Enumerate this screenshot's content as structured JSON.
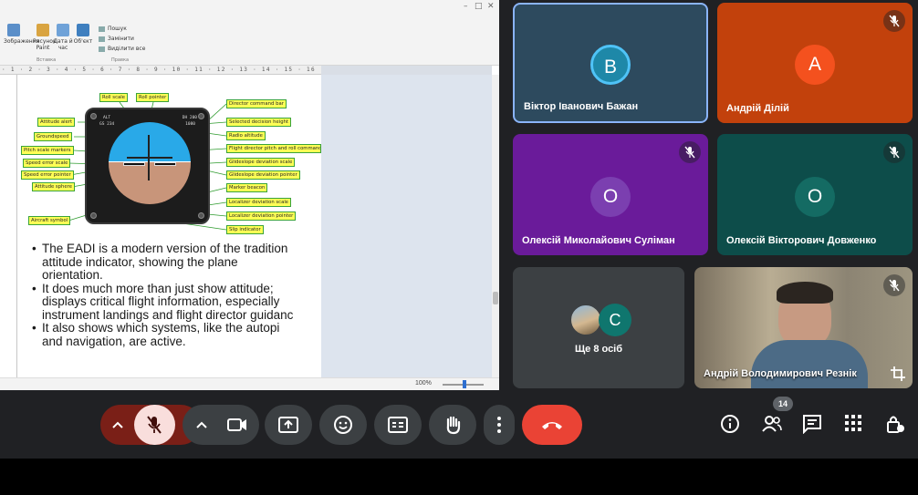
{
  "presentation": {
    "ribbon": {
      "buttons": [
        "Зображення",
        "Рисунок Paint",
        "Дата й час",
        "Об'єкт"
      ],
      "right_items": [
        "Пошук",
        "Замінити",
        "Виділити все"
      ],
      "groups": [
        "Вставка",
        "Правка"
      ]
    },
    "ruler_text": "· 1 · 2 · 3 · 4 · 5 · 6 · 7 · 8 · 9 · 10 · 11 · 12 · 13 · 14 · 15 · 16 · 17 ·",
    "zoom_label": "100%",
    "eadi_callouts": [
      "Roll scale",
      "Roll pointer",
      "Attitude alert",
      "Groundspeed",
      "Pitch scale markers",
      "Speed error scale",
      "Speed error pointer",
      "Attitude sphere",
      "Aircraft symbol",
      "Director command bar",
      "Selected decision height",
      "Radio altitude",
      "Flight director pitch and roll command",
      "Glideslope deviation scale",
      "Glideslope deviation pointer",
      "Marker beacon",
      "Localizer deviation scale",
      "Localizer deviation pointer",
      "Slip indicator"
    ],
    "instrument_texts": [
      "ALT",
      "GS 234",
      "DH 200",
      "1080"
    ],
    "bullets": [
      "The EADI is a modern version of the tradition",
      "attitude   indicator,   showing   the   plane",
      "orientation.",
      "It does much more than just show attitude;",
      "displays critical flight information, especially",
      "instrument landings and flight director guidanc",
      "It also shows which systems, like the autopi",
      "and navigation, are active."
    ]
  },
  "participants": [
    {
      "initial": "В",
      "name": "Віктор Іванович Бажан",
      "tile_color": "#2d4a5e",
      "avatar_color": "#1e88a8",
      "muted": false,
      "active_speaker": true
    },
    {
      "initial": "А",
      "name": "Андрій Ділій",
      "tile_color": "#c2410c",
      "avatar_color": "#f4511e",
      "muted": true
    },
    {
      "initial": "О",
      "name": "Олексій Миколайович Суліман",
      "tile_color": "#6a1b9a",
      "avatar_color": "#7b3fb0",
      "muted": true
    },
    {
      "initial": "О",
      "name": "Олексій Вікторович Довженко",
      "tile_color": "#0d4d4a",
      "avatar_color": "#146b63",
      "muted": true
    },
    {
      "initial": "С",
      "name": "Ще 8 осіб",
      "tile_color": "#3c4043",
      "avatar_color": "#0f766e",
      "muted": false
    },
    {
      "initial": "",
      "name": "Андрій Володимирович Резнік",
      "tile_color": "#5b5246",
      "avatar_color": "#000000",
      "muted": true
    }
  ],
  "controls": {
    "participant_count": "14"
  },
  "colors": {
    "background": "#202124",
    "button": "#3c4043",
    "end_call": "#ea4335",
    "mic_off": "#f9dedc",
    "active_border": "#8ab4f8"
  }
}
